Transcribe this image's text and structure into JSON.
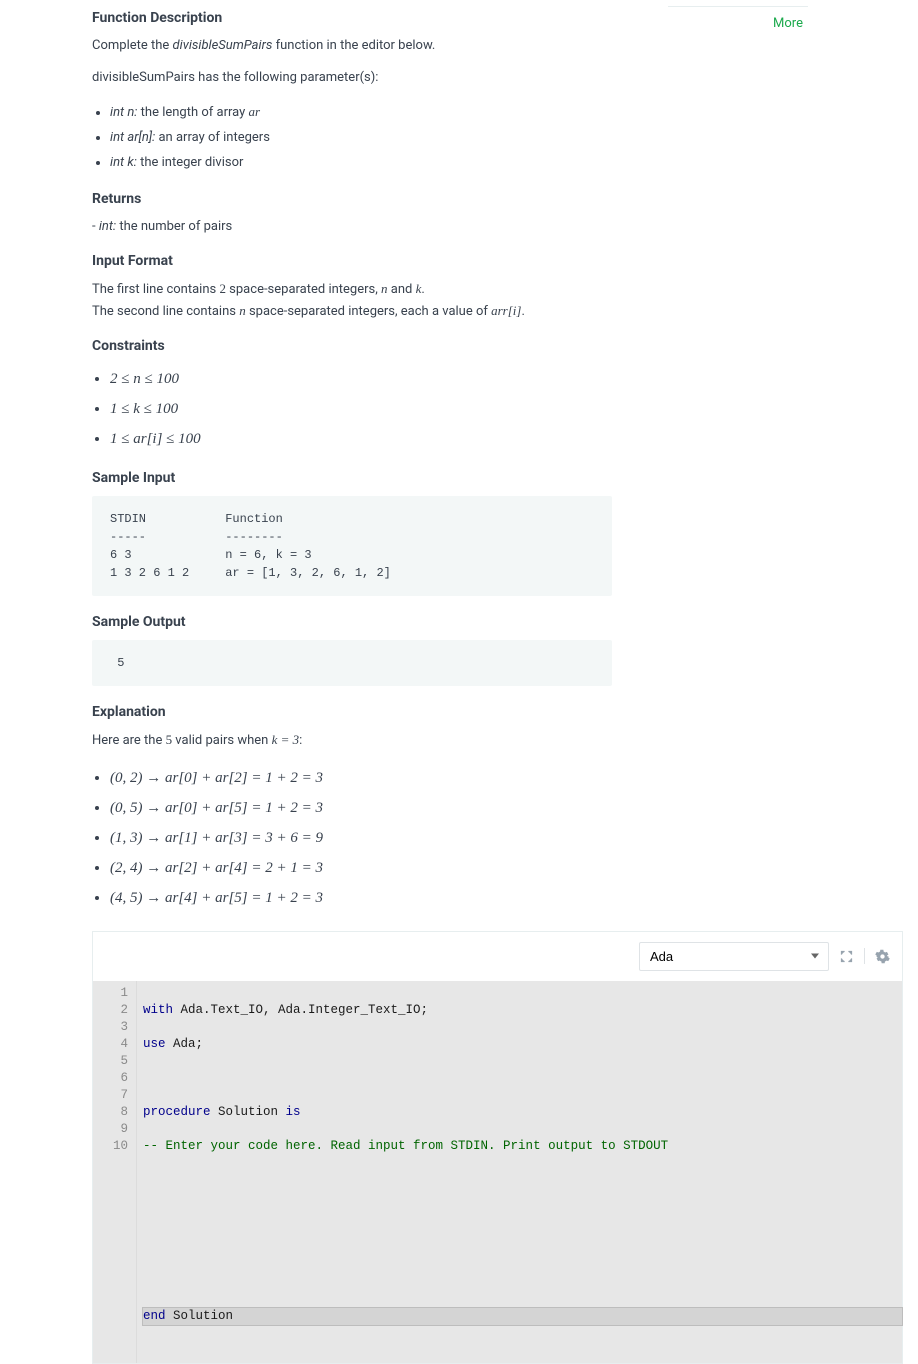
{
  "more_label": "More",
  "headings": {
    "func_desc": "Function Description",
    "returns": "Returns",
    "input_format": "Input Format",
    "constraints": "Constraints",
    "sample_input": "Sample Input",
    "sample_output": "Sample Output",
    "explanation": "Explanation"
  },
  "func_desc_intro_pre": "Complete the ",
  "func_desc_intro_fn": "divisibleSumPairs",
  "func_desc_intro_post": " function in the editor below.",
  "func_params_lead_pre": "divisibleSumPairs has the following parameter(s):",
  "params": {
    "p1_sig": "int n:",
    "p1_desc": " the length of array ",
    "p1_tail": "ar",
    "p2_sig": "int ar[n]:",
    "p2_desc": " an array of integers",
    "p3_sig": "int k:",
    "p3_desc": " the integer divisor"
  },
  "returns_line_pre": "- ",
  "returns_line_sig": "int:",
  "returns_line_desc": " the number of pairs",
  "input_format_line1a": "The first line contains ",
  "input_format_line1b": "2",
  "input_format_line1c": " space-separated integers, ",
  "input_format_line1d": "n",
  "input_format_line1e": " and ",
  "input_format_line1f": "k",
  "input_format_line1g": ".",
  "input_format_line2a": "The second line contains ",
  "input_format_line2b": "n",
  "input_format_line2c": " space-separated integers, each a value of ",
  "input_format_line2d": "arr[i]",
  "input_format_line2e": ".",
  "constraints": {
    "c1": "2 ≤ n ≤ 100",
    "c2": "1 ≤ k ≤ 100",
    "c3": "1 ≤ ar[i] ≤ 100"
  },
  "sample_input_text": "STDIN           Function\n-----           --------\n6 3             n = 6, k = 3\n1 3 2 6 1 2     ar = [1, 3, 2, 6, 1, 2]",
  "sample_output_text": " 5",
  "explanation_intro_a": "Here are the ",
  "explanation_intro_b": "5",
  "explanation_intro_c": " valid pairs when ",
  "explanation_intro_d": "k = 3",
  "explanation_intro_e": ":",
  "explain_items": {
    "e1": "(0, 2) → ar[0] + ar[2] = 1 + 2 = 3",
    "e2": "(0, 5) → ar[0] + ar[5] = 1 + 2 = 3",
    "e3": "(1, 3) → ar[1] + ar[3] = 3 + 6 = 9",
    "e4": "(2, 4) → ar[2] + ar[4] = 2 + 1 = 3",
    "e5": "(4, 5) → ar[4] + ar[5] = 1 + 2 = 3"
  },
  "editor": {
    "language": "Ada",
    "lines": {
      "l1a": "with",
      "l1b": " Ada.Text_IO, Ada.Integer_Text_IO;",
      "l2a": "use",
      "l2b": " Ada;",
      "l3": "",
      "l4a": "procedure",
      "l4b": " Solution ",
      "l4c": "is",
      "l5": "-- Enter your code here. Read input from STDIN. Print output to STDOUT",
      "l6": "",
      "l7": "",
      "l8": "",
      "l9": "",
      "l10a": "end",
      "l10b": " Solution"
    },
    "line_numbers": {
      "n1": "1",
      "n2": "2",
      "n3": "3",
      "n4": "4",
      "n5": "5",
      "n6": "6",
      "n7": "7",
      "n8": "8",
      "n9": "9",
      "n10": "10"
    }
  }
}
